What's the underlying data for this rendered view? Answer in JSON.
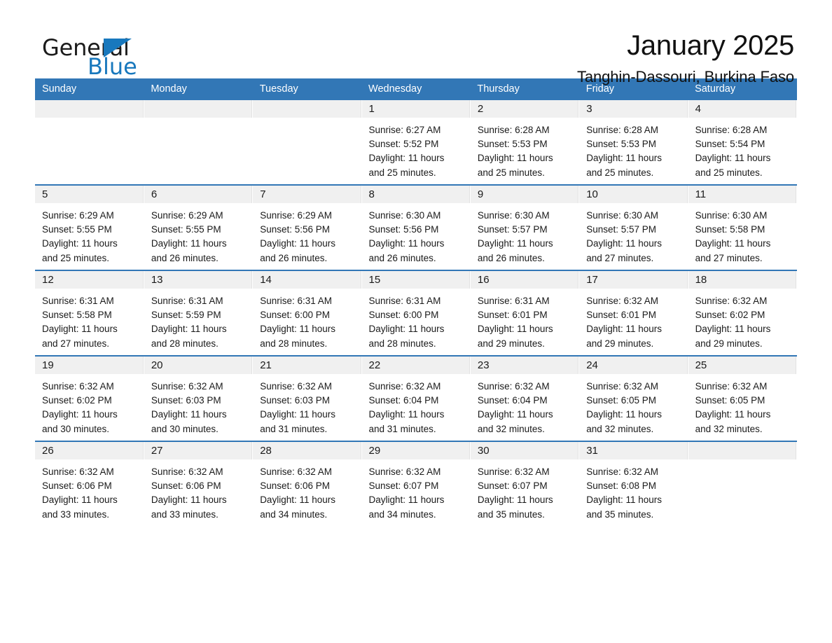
{
  "brand": {
    "name_part1": "General",
    "name_part2": "Blue",
    "triangle_color": "#1878bd"
  },
  "header": {
    "month_title": "January 2025",
    "location": "Tanghin-Dassouri, Burkina Faso"
  },
  "theme": {
    "header_blue": "#3277b6",
    "day_band_gray": "#f0f0f0",
    "text_color": "#1a1a1a"
  },
  "weekdays": [
    "Sunday",
    "Monday",
    "Tuesday",
    "Wednesday",
    "Thursday",
    "Friday",
    "Saturday"
  ],
  "weeks": [
    [
      {
        "day": "",
        "sunrise": "",
        "sunset": "",
        "daylight_line1": "",
        "daylight_line2": "",
        "empty": true
      },
      {
        "day": "",
        "sunrise": "",
        "sunset": "",
        "daylight_line1": "",
        "daylight_line2": "",
        "empty": true
      },
      {
        "day": "",
        "sunrise": "",
        "sunset": "",
        "daylight_line1": "",
        "daylight_line2": "",
        "empty": true
      },
      {
        "day": "1",
        "sunrise": "Sunrise: 6:27 AM",
        "sunset": "Sunset: 5:52 PM",
        "daylight_line1": "Daylight: 11 hours",
        "daylight_line2": "and 25 minutes."
      },
      {
        "day": "2",
        "sunrise": "Sunrise: 6:28 AM",
        "sunset": "Sunset: 5:53 PM",
        "daylight_line1": "Daylight: 11 hours",
        "daylight_line2": "and 25 minutes."
      },
      {
        "day": "3",
        "sunrise": "Sunrise: 6:28 AM",
        "sunset": "Sunset: 5:53 PM",
        "daylight_line1": "Daylight: 11 hours",
        "daylight_line2": "and 25 minutes."
      },
      {
        "day": "4",
        "sunrise": "Sunrise: 6:28 AM",
        "sunset": "Sunset: 5:54 PM",
        "daylight_line1": "Daylight: 11 hours",
        "daylight_line2": "and 25 minutes."
      }
    ],
    [
      {
        "day": "5",
        "sunrise": "Sunrise: 6:29 AM",
        "sunset": "Sunset: 5:55 PM",
        "daylight_line1": "Daylight: 11 hours",
        "daylight_line2": "and 25 minutes."
      },
      {
        "day": "6",
        "sunrise": "Sunrise: 6:29 AM",
        "sunset": "Sunset: 5:55 PM",
        "daylight_line1": "Daylight: 11 hours",
        "daylight_line2": "and 26 minutes."
      },
      {
        "day": "7",
        "sunrise": "Sunrise: 6:29 AM",
        "sunset": "Sunset: 5:56 PM",
        "daylight_line1": "Daylight: 11 hours",
        "daylight_line2": "and 26 minutes."
      },
      {
        "day": "8",
        "sunrise": "Sunrise: 6:30 AM",
        "sunset": "Sunset: 5:56 PM",
        "daylight_line1": "Daylight: 11 hours",
        "daylight_line2": "and 26 minutes."
      },
      {
        "day": "9",
        "sunrise": "Sunrise: 6:30 AM",
        "sunset": "Sunset: 5:57 PM",
        "daylight_line1": "Daylight: 11 hours",
        "daylight_line2": "and 26 minutes."
      },
      {
        "day": "10",
        "sunrise": "Sunrise: 6:30 AM",
        "sunset": "Sunset: 5:57 PM",
        "daylight_line1": "Daylight: 11 hours",
        "daylight_line2": "and 27 minutes."
      },
      {
        "day": "11",
        "sunrise": "Sunrise: 6:30 AM",
        "sunset": "Sunset: 5:58 PM",
        "daylight_line1": "Daylight: 11 hours",
        "daylight_line2": "and 27 minutes."
      }
    ],
    [
      {
        "day": "12",
        "sunrise": "Sunrise: 6:31 AM",
        "sunset": "Sunset: 5:58 PM",
        "daylight_line1": "Daylight: 11 hours",
        "daylight_line2": "and 27 minutes."
      },
      {
        "day": "13",
        "sunrise": "Sunrise: 6:31 AM",
        "sunset": "Sunset: 5:59 PM",
        "daylight_line1": "Daylight: 11 hours",
        "daylight_line2": "and 28 minutes."
      },
      {
        "day": "14",
        "sunrise": "Sunrise: 6:31 AM",
        "sunset": "Sunset: 6:00 PM",
        "daylight_line1": "Daylight: 11 hours",
        "daylight_line2": "and 28 minutes."
      },
      {
        "day": "15",
        "sunrise": "Sunrise: 6:31 AM",
        "sunset": "Sunset: 6:00 PM",
        "daylight_line1": "Daylight: 11 hours",
        "daylight_line2": "and 28 minutes."
      },
      {
        "day": "16",
        "sunrise": "Sunrise: 6:31 AM",
        "sunset": "Sunset: 6:01 PM",
        "daylight_line1": "Daylight: 11 hours",
        "daylight_line2": "and 29 minutes."
      },
      {
        "day": "17",
        "sunrise": "Sunrise: 6:32 AM",
        "sunset": "Sunset: 6:01 PM",
        "daylight_line1": "Daylight: 11 hours",
        "daylight_line2": "and 29 minutes."
      },
      {
        "day": "18",
        "sunrise": "Sunrise: 6:32 AM",
        "sunset": "Sunset: 6:02 PM",
        "daylight_line1": "Daylight: 11 hours",
        "daylight_line2": "and 29 minutes."
      }
    ],
    [
      {
        "day": "19",
        "sunrise": "Sunrise: 6:32 AM",
        "sunset": "Sunset: 6:02 PM",
        "daylight_line1": "Daylight: 11 hours",
        "daylight_line2": "and 30 minutes."
      },
      {
        "day": "20",
        "sunrise": "Sunrise: 6:32 AM",
        "sunset": "Sunset: 6:03 PM",
        "daylight_line1": "Daylight: 11 hours",
        "daylight_line2": "and 30 minutes."
      },
      {
        "day": "21",
        "sunrise": "Sunrise: 6:32 AM",
        "sunset": "Sunset: 6:03 PM",
        "daylight_line1": "Daylight: 11 hours",
        "daylight_line2": "and 31 minutes."
      },
      {
        "day": "22",
        "sunrise": "Sunrise: 6:32 AM",
        "sunset": "Sunset: 6:04 PM",
        "daylight_line1": "Daylight: 11 hours",
        "daylight_line2": "and 31 minutes."
      },
      {
        "day": "23",
        "sunrise": "Sunrise: 6:32 AM",
        "sunset": "Sunset: 6:04 PM",
        "daylight_line1": "Daylight: 11 hours",
        "daylight_line2": "and 32 minutes."
      },
      {
        "day": "24",
        "sunrise": "Sunrise: 6:32 AM",
        "sunset": "Sunset: 6:05 PM",
        "daylight_line1": "Daylight: 11 hours",
        "daylight_line2": "and 32 minutes."
      },
      {
        "day": "25",
        "sunrise": "Sunrise: 6:32 AM",
        "sunset": "Sunset: 6:05 PM",
        "daylight_line1": "Daylight: 11 hours",
        "daylight_line2": "and 32 minutes."
      }
    ],
    [
      {
        "day": "26",
        "sunrise": "Sunrise: 6:32 AM",
        "sunset": "Sunset: 6:06 PM",
        "daylight_line1": "Daylight: 11 hours",
        "daylight_line2": "and 33 minutes."
      },
      {
        "day": "27",
        "sunrise": "Sunrise: 6:32 AM",
        "sunset": "Sunset: 6:06 PM",
        "daylight_line1": "Daylight: 11 hours",
        "daylight_line2": "and 33 minutes."
      },
      {
        "day": "28",
        "sunrise": "Sunrise: 6:32 AM",
        "sunset": "Sunset: 6:06 PM",
        "daylight_line1": "Daylight: 11 hours",
        "daylight_line2": "and 34 minutes."
      },
      {
        "day": "29",
        "sunrise": "Sunrise: 6:32 AM",
        "sunset": "Sunset: 6:07 PM",
        "daylight_line1": "Daylight: 11 hours",
        "daylight_line2": "and 34 minutes."
      },
      {
        "day": "30",
        "sunrise": "Sunrise: 6:32 AM",
        "sunset": "Sunset: 6:07 PM",
        "daylight_line1": "Daylight: 11 hours",
        "daylight_line2": "and 35 minutes."
      },
      {
        "day": "31",
        "sunrise": "Sunrise: 6:32 AM",
        "sunset": "Sunset: 6:08 PM",
        "daylight_line1": "Daylight: 11 hours",
        "daylight_line2": "and 35 minutes."
      },
      {
        "day": "",
        "sunrise": "",
        "sunset": "",
        "daylight_line1": "",
        "daylight_line2": "",
        "empty": true
      }
    ]
  ]
}
